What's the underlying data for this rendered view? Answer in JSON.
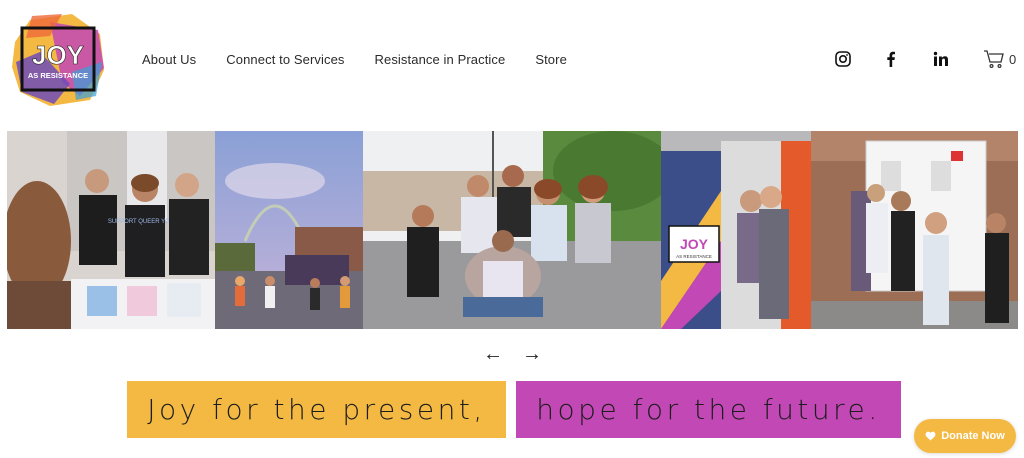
{
  "logo": {
    "line1": "JOY",
    "line2": "AS RESISTANCE"
  },
  "nav": {
    "items": [
      "About Us",
      "Connect to Services",
      "Resistance in Practice",
      "Store"
    ]
  },
  "social": {
    "icons": [
      "instagram-icon",
      "facebook-icon",
      "linkedin-icon"
    ]
  },
  "cart": {
    "count": "0"
  },
  "gallery": {
    "photo1_sign": "SUPPORT QUEER YOUTH",
    "photo5_sign_line1": "JOY",
    "photo5_sign_line2": "AS RESISTANCE"
  },
  "carousel": {
    "prev": "←",
    "next": "→"
  },
  "tagline": {
    "left": "Joy for the present,",
    "right": "hope for the future."
  },
  "donate": {
    "label": "Donate Now"
  },
  "colors": {
    "yellow": "#f4b942",
    "magenta": "#c148b5"
  }
}
